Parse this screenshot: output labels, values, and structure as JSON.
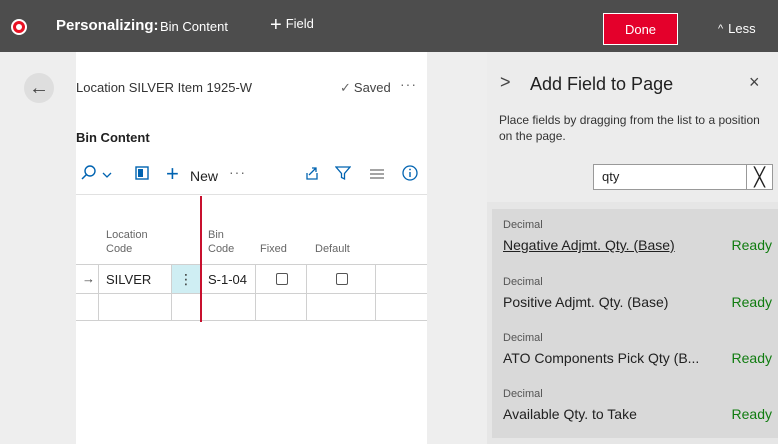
{
  "topbar": {
    "mode_label": "Personalizing:",
    "page_name": "Bin Content",
    "add_field_label": "Field",
    "done_label": "Done",
    "less_label": "Less"
  },
  "page": {
    "breadcrumb": "Location SILVER Item 1925-W",
    "saved_label": "Saved",
    "part_title": "Bin Content",
    "toolbar": {
      "new_label": "New"
    }
  },
  "grid": {
    "headers": {
      "location_code": [
        "Location",
        "Code"
      ],
      "bin_code": [
        "Bin",
        "Code"
      ],
      "fixed": "Fixed",
      "default": "Default"
    },
    "rows": [
      {
        "location_code": "SILVER",
        "bin_code": "S-1-04",
        "fixed": false,
        "default": false
      }
    ]
  },
  "pane": {
    "title": "Add Field to Page",
    "help_text": "Place fields by dragging from the list to a position on the page.",
    "search_value": "qty",
    "fields": [
      {
        "type": "Decimal",
        "name": "Negative Adjmt. Qty. (Base)",
        "status": "Ready"
      },
      {
        "type": "Decimal",
        "name": "Positive Adjmt. Qty. (Base)",
        "status": "Ready"
      },
      {
        "type": "Decimal",
        "name": "ATO Components Pick Qty (B...",
        "status": "Ready"
      },
      {
        "type": "Decimal",
        "name": "Available Qty. to Take",
        "status": "Ready"
      }
    ]
  },
  "colors": {
    "topbar_bg": "#4d4d4d",
    "done_bg": "#e4002b",
    "accent_blue": "#0063b1",
    "ready_green": "#107c10",
    "drop_indicator": "#c8102e"
  },
  "icons": [
    "record-icon",
    "plus-icon",
    "chevron-up-icon",
    "back-arrow-icon",
    "checkmark-icon",
    "more-icon",
    "search-icon",
    "chevron-down-icon",
    "excel-icon",
    "share-icon",
    "filter-icon",
    "list-icon",
    "info-icon",
    "row-arrow-icon",
    "chevron-right-icon",
    "close-icon"
  ]
}
